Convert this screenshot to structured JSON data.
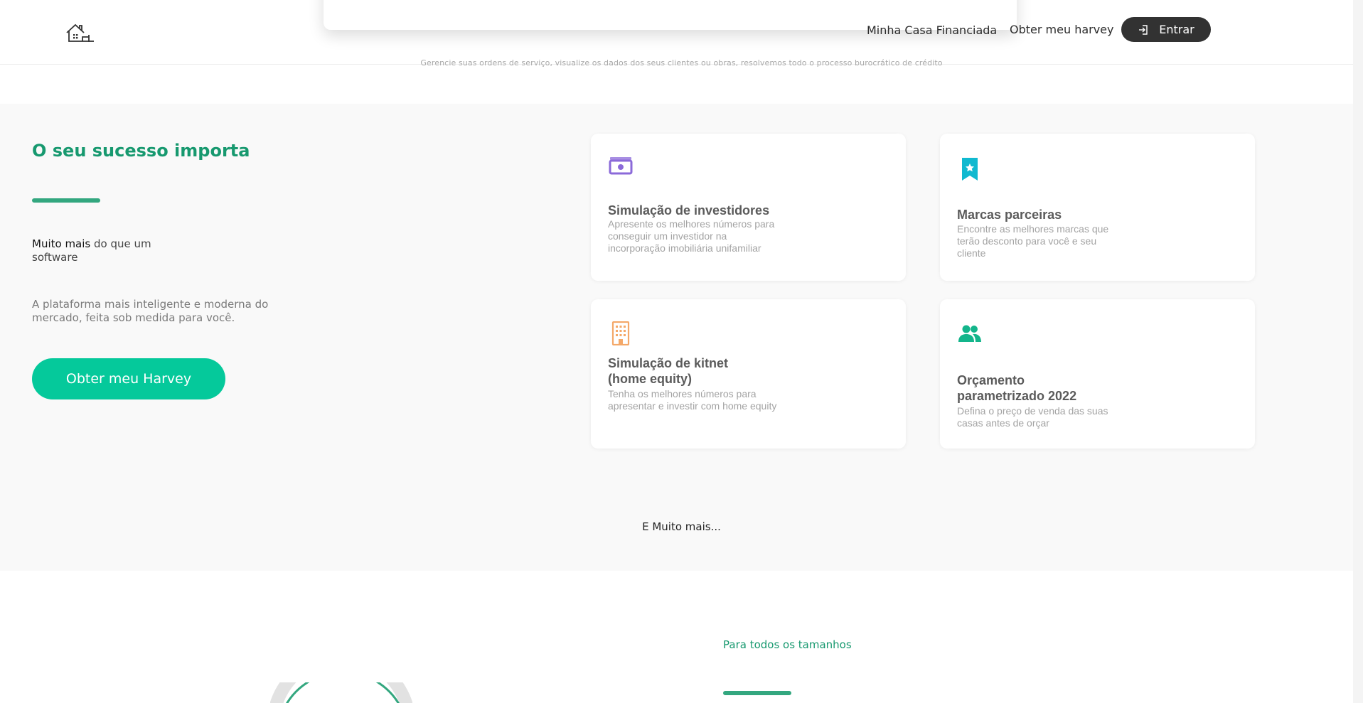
{
  "header": {
    "nav_links": [
      "Minha Casa Financiada",
      "Obter meu harvey"
    ],
    "login_label": "Entrar",
    "background_note": "Gerencie suas ordens de serviço, visualize os dados dos seus clientes ou obras, resolvemos todo o processo burocrático de crédito"
  },
  "success": {
    "title": "O seu sucesso importa",
    "subtitle_strong": "Muito mais",
    "subtitle_rest": " do que um software",
    "description": "A plataforma mais inteligente e moderna do mercado, feita sob medida para você.",
    "cta_label": "Obter meu Harvey"
  },
  "features": [
    {
      "icon": "money-icon",
      "color": "#8b6ad9",
      "title": "Simulação de investidores",
      "text": "Apresente os melhores números para conseguir um investidor na incorporação imobiliária unifamiliar"
    },
    {
      "icon": "bookmark-star-icon",
      "color": "#10b9d0",
      "title": "Marcas parceiras",
      "text": "Encontre as melhores marcas que terão desconto para você e seu cliente"
    },
    {
      "icon": "building-icon",
      "color": "#f4a869",
      "title": "Simulação de kitnet (home equity)",
      "text": "Tenha os melhores números para apresentar e investir com home equity"
    },
    {
      "icon": "users-icon",
      "color": "#13b58b",
      "title": "Orçamento parametrizado 2022",
      "text": "Defina o preço de venda das suas casas antes de orçar"
    }
  ],
  "more_text": "E Muito mais...",
  "sizes": {
    "label": "Para todos os tamanhos"
  },
  "colors": {
    "brand_green": "#05c99b",
    "title_green": "#17996f",
    "dark_button": "#323232"
  }
}
